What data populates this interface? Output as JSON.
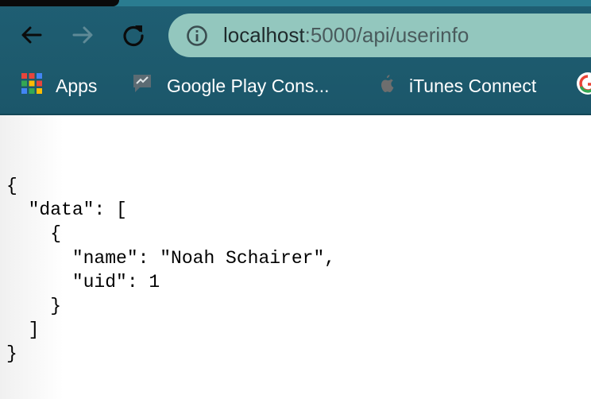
{
  "browser": {
    "url_host": "localhost",
    "url_rest": ":5000/api/userinfo",
    "toolbar": {
      "back_icon": "arrow-left-icon",
      "forward_icon": "arrow-right-icon",
      "reload_icon": "reload-icon",
      "site_info_icon": "info-icon"
    },
    "bookmarks": [
      {
        "label": "Apps",
        "icon": "apps-grid-icon"
      },
      {
        "label": "Google Play Cons...",
        "icon": "play-console-icon"
      },
      {
        "label": "iTunes Connect",
        "icon": "apple-icon"
      },
      {
        "label": "",
        "icon": "google-icon"
      }
    ],
    "colors": {
      "chrome": "#1f5e73",
      "omnibox": "#93c7be"
    }
  },
  "page": {
    "json_text": "{\n  \"data\": [\n    {\n      \"name\": \"Noah Schairer\",\n      \"uid\": 1\n    }\n  ]\n}"
  }
}
